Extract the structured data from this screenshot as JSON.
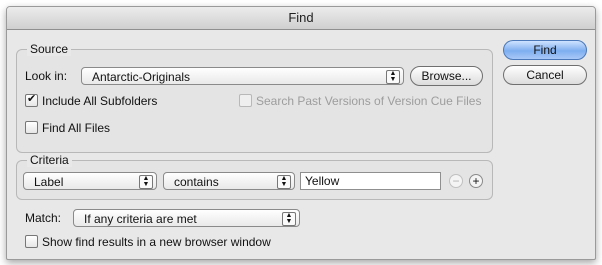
{
  "window": {
    "title": "Find"
  },
  "buttons": {
    "find": "Find",
    "cancel": "Cancel",
    "browse": "Browse..."
  },
  "source": {
    "title": "Source",
    "look_in_label": "Look in:",
    "look_in_value": "Antarctic-Originals",
    "include_subfolders": {
      "label": "Include All Subfolders",
      "checked": true
    },
    "search_versions": {
      "label": "Search Past Versions of Version Cue Files",
      "checked": false,
      "disabled": true
    },
    "find_all_files": {
      "label": "Find All Files",
      "checked": false
    }
  },
  "criteria": {
    "title": "Criteria",
    "field_value": "Label",
    "operator_value": "contains",
    "text_value": "Yellow",
    "remove_symbol": "−",
    "add_symbol": "+"
  },
  "match": {
    "label": "Match:",
    "value": "If any criteria are met"
  },
  "show_results": {
    "label": "Show find results in a new browser window",
    "checked": false
  },
  "icons": {
    "popup_arrows": "updown-arrows-icon"
  }
}
